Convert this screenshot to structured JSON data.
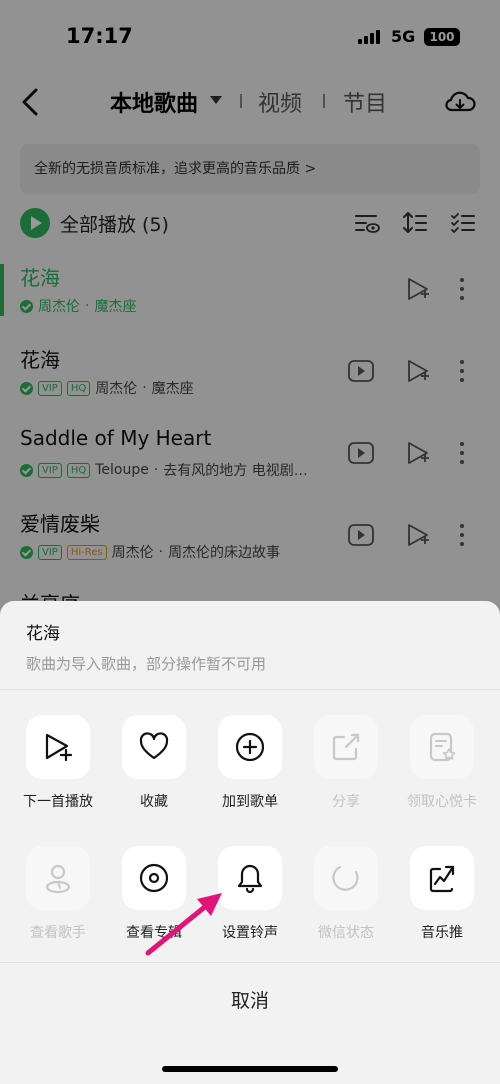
{
  "status_bar": {
    "time": "17:17",
    "network": "5G",
    "battery": "100"
  },
  "navbar": {
    "title": "本地歌曲",
    "tabs": [
      "视频",
      "节目"
    ]
  },
  "banner": {
    "text": "全新的无损音质标准，追求更高的音乐品质 >"
  },
  "play_all": {
    "label": "全部播放 (5)"
  },
  "songs": [
    {
      "title": "花海",
      "artist": "周杰伦",
      "album": "魔杰座",
      "tags": [],
      "active": true,
      "accent": "#2db45a"
    },
    {
      "title": "花海",
      "artist": "周杰伦",
      "album": "魔杰座",
      "tags": [
        "VIP",
        "HQ"
      ],
      "active": false
    },
    {
      "title": "Saddle of My Heart",
      "artist": "Teloupe",
      "album": "去有风的地方 电视剧…",
      "tags": [
        "VIP",
        "HQ"
      ],
      "active": false
    },
    {
      "title": "爱情废柴",
      "artist": "周杰伦",
      "album": "周杰伦的床边故事",
      "tags": [
        "VIP",
        "Hi-Res"
      ],
      "active": false
    },
    {
      "title": "兰亭序",
      "artist": "",
      "album": "",
      "tags": [],
      "active": false
    }
  ],
  "sheet": {
    "title": "花海",
    "subtitle": "歌曲为导入歌曲，部分操作暂不可用",
    "row1": [
      {
        "label": "下一首播放",
        "icon": "play-next-icon",
        "enabled": true
      },
      {
        "label": "收藏",
        "icon": "heart-icon",
        "enabled": true
      },
      {
        "label": "加到歌单",
        "icon": "add-playlist-icon",
        "enabled": true
      },
      {
        "label": "分享",
        "icon": "share-icon",
        "enabled": false
      },
      {
        "label": "领取心悦卡",
        "icon": "card-icon",
        "enabled": false
      }
    ],
    "row2": [
      {
        "label": "查看歌手",
        "icon": "singer-icon",
        "enabled": false
      },
      {
        "label": "查看专辑",
        "icon": "album-icon",
        "enabled": true
      },
      {
        "label": "设置铃声",
        "icon": "bell-icon",
        "enabled": true
      },
      {
        "label": "微信状态",
        "icon": "wechat-status-icon",
        "enabled": false
      },
      {
        "label": "音乐推",
        "icon": "music-push-icon",
        "enabled": true
      }
    ],
    "cancel": "取消"
  },
  "colors": {
    "accent": "#2db45a",
    "highlight_arrow": "#e0157a"
  }
}
